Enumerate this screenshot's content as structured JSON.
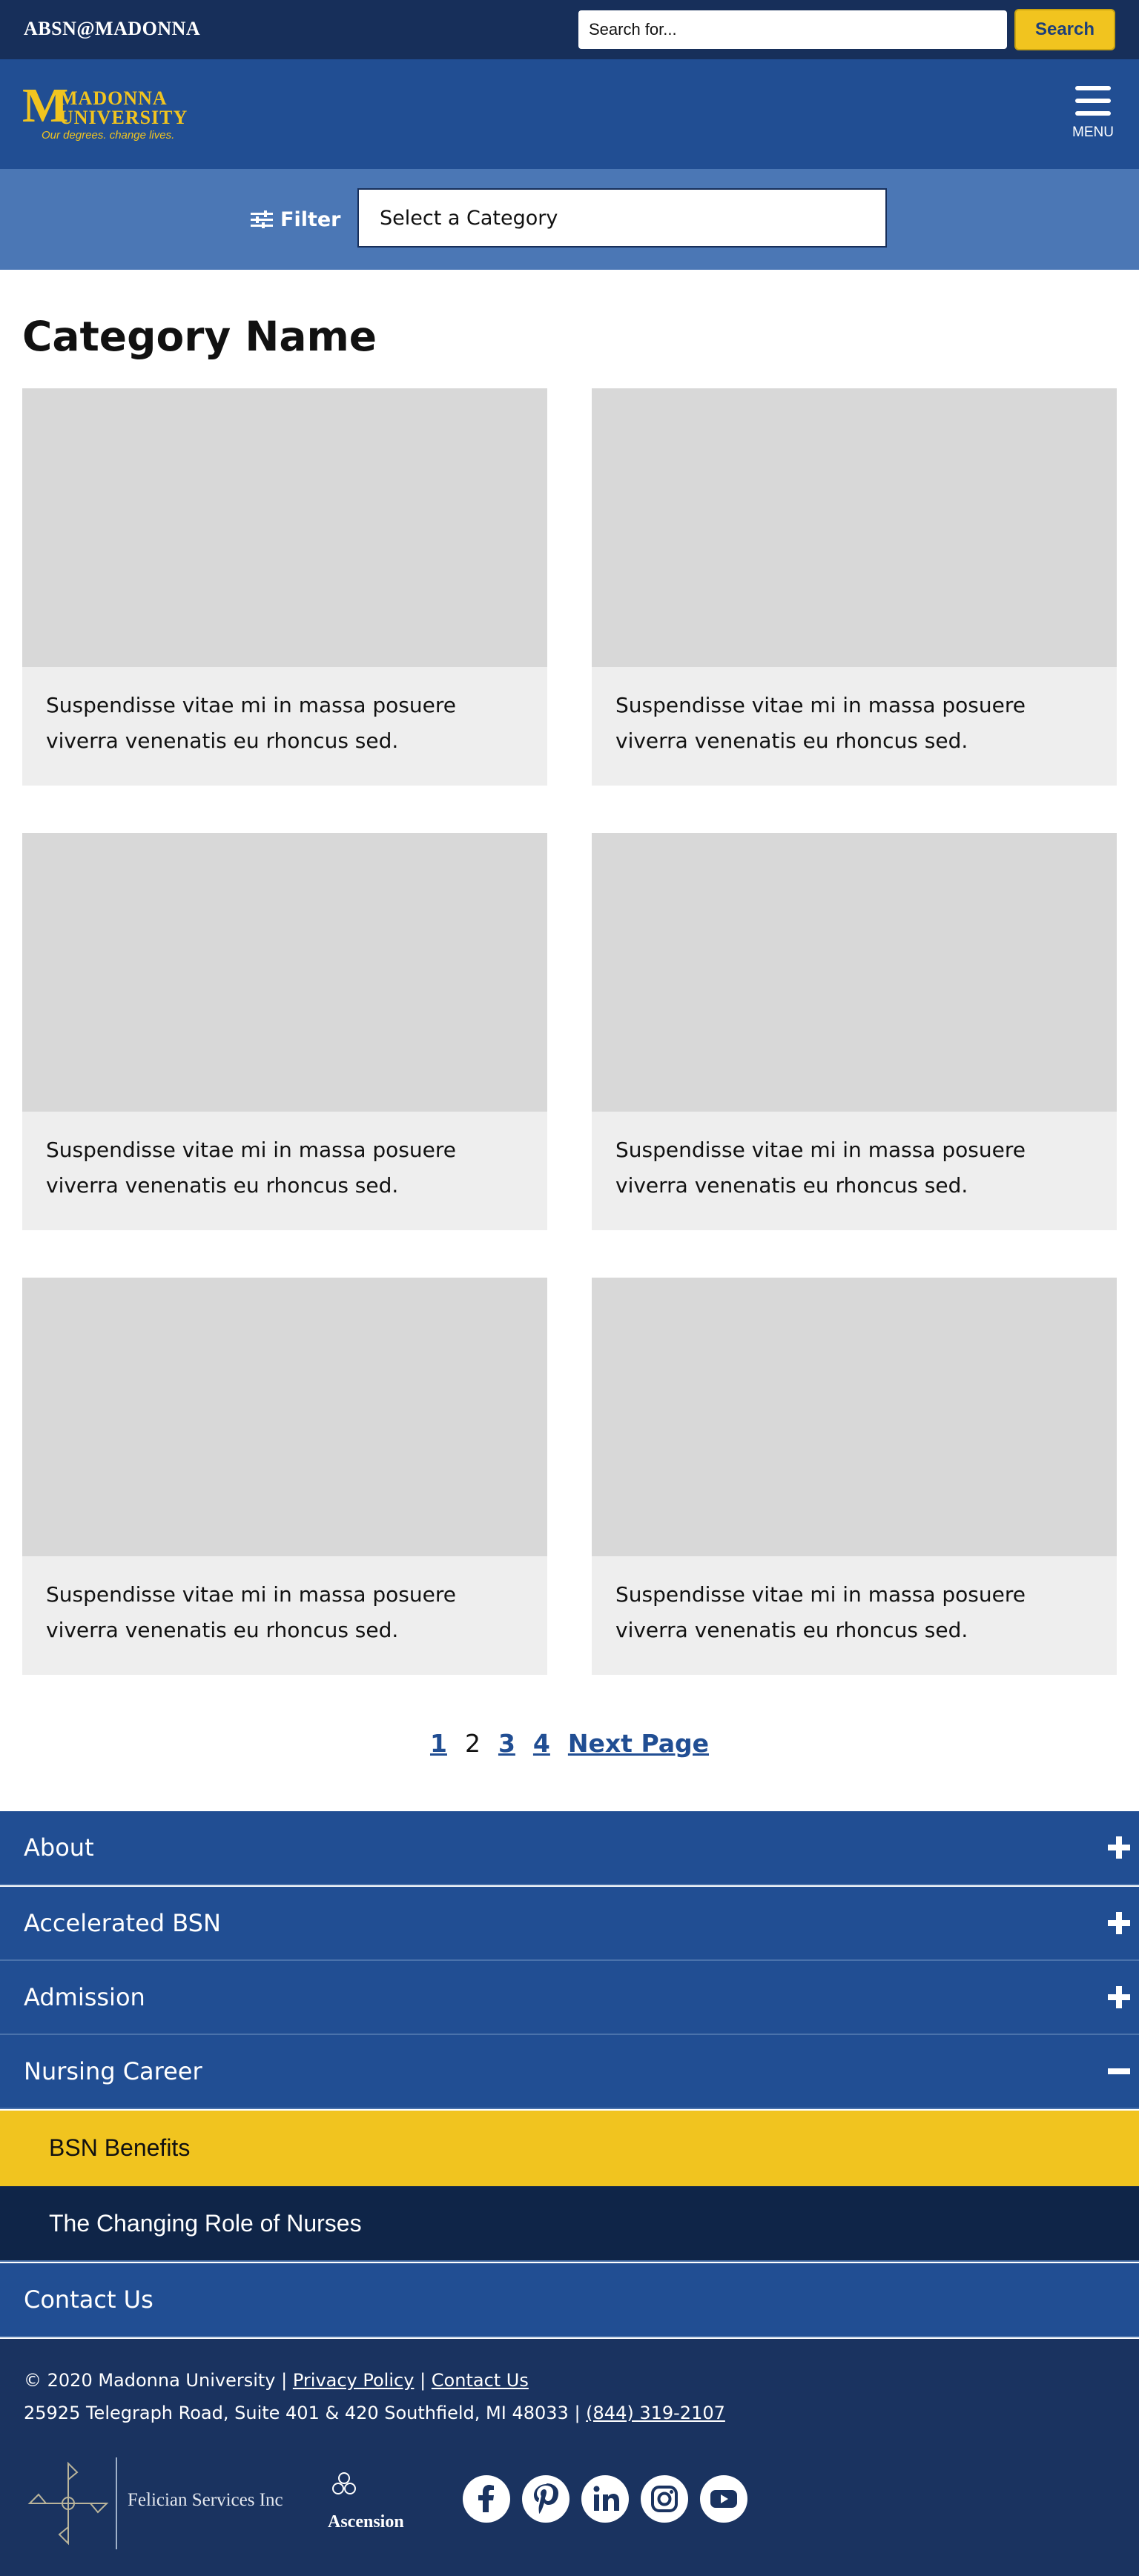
{
  "topbar": {
    "site_label": "ABSN@MADONNA",
    "search_placeholder": "Search for...",
    "search_button": "Search"
  },
  "header": {
    "logo": {
      "line1": "MADONNA",
      "line2": "UNIVERSITY",
      "tagline": "Our degrees. change lives."
    },
    "menu_label": "MENU"
  },
  "filter": {
    "label": "Filter",
    "select_value": "Select a Category"
  },
  "category": {
    "title": "Category Name",
    "cards": [
      {
        "text": "Suspendisse vitae mi in massa posuere viverra venenatis eu rhoncus sed."
      },
      {
        "text": "Suspendisse vitae mi in massa posuere viverra venenatis eu rhoncus sed."
      },
      {
        "text": "Suspendisse vitae mi in massa posuere viverra venenatis eu rhoncus sed."
      },
      {
        "text": "Suspendisse vitae mi in massa posuere viverra venenatis eu rhoncus sed."
      },
      {
        "text": "Suspendisse vitae mi in massa posuere viverra venenatis eu rhoncus sed."
      },
      {
        "text": "Suspendisse vitae mi in massa posuere viverra venenatis eu rhoncus sed."
      }
    ]
  },
  "pagination": {
    "pages": [
      "1",
      "2",
      "3",
      "4"
    ],
    "current": "2",
    "next_label": "Next Page"
  },
  "footer_nav": {
    "items": [
      {
        "label": "About",
        "state": "collapsed"
      },
      {
        "label": "Accelerated BSN",
        "state": "collapsed"
      },
      {
        "label": "Admission",
        "state": "collapsed"
      },
      {
        "label": "Nursing Career",
        "state": "expanded"
      }
    ],
    "sub_items": [
      {
        "label": "BSN Benefits",
        "active": true
      },
      {
        "label": "The Changing Role of Nurses",
        "active": false
      }
    ],
    "contact": {
      "label": "Contact Us"
    }
  },
  "footer": {
    "copyright": "© 2020 Madonna University |",
    "privacy_link": "Privacy Policy",
    "separator": "|",
    "contact_link": "Contact Us",
    "address": "25925 Telegraph Road, Suite 401 & 420 Southfield, MI 48033 |",
    "phone": "(844) 319-2107",
    "partners": [
      "Felician Services Inc",
      "Ascension"
    ],
    "social_icons": [
      "facebook-icon",
      "pinterest-icon",
      "linkedin-icon",
      "instagram-icon",
      "youtube-icon"
    ]
  },
  "colors": {
    "navy": "#172f5a",
    "brand_blue": "#214e93",
    "filter_blue": "#4b77b5",
    "gold": "#f1c41f",
    "deep_navy": "#0f2548",
    "card_bg": "#eeeeee",
    "image_placeholder": "#d8d8d8"
  }
}
